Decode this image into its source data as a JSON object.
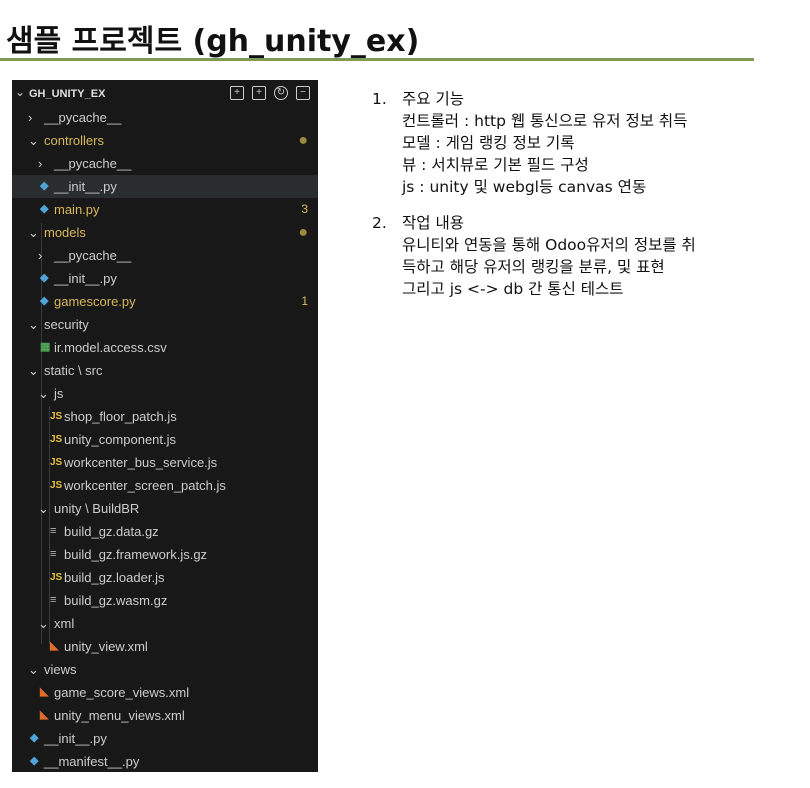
{
  "slide": {
    "title": "샘플 프로젝트 (gh_unity_ex)"
  },
  "explorer": {
    "root": "GH_UNITY_EX",
    "toolbar_icons": [
      "new-file-icon",
      "new-folder-icon",
      "refresh-icon",
      "collapse-all-icon"
    ],
    "items": [
      {
        "label": "__pycache__",
        "type": "folder",
        "collapsed": true
      },
      {
        "label": "controllers",
        "type": "folder",
        "badge": "●"
      },
      {
        "label": "__pycache__",
        "type": "folder",
        "collapsed": true
      },
      {
        "label": "__init__.py",
        "type": "py"
      },
      {
        "label": "main.py",
        "type": "py",
        "badge": "3"
      },
      {
        "label": "models",
        "type": "folder",
        "badge": "●"
      },
      {
        "label": "__pycache__",
        "type": "folder",
        "collapsed": true
      },
      {
        "label": "__init__.py",
        "type": "py"
      },
      {
        "label": "gamescore.py",
        "type": "py",
        "badge": "1"
      },
      {
        "label": "security",
        "type": "folder"
      },
      {
        "label": "ir.model.access.csv",
        "type": "csv"
      },
      {
        "label": "static \\ src",
        "type": "folder"
      },
      {
        "label": "js",
        "type": "folder"
      },
      {
        "label": "shop_floor_patch.js",
        "type": "js"
      },
      {
        "label": "unity_component.js",
        "type": "js"
      },
      {
        "label": "workcenter_bus_service.js",
        "type": "js"
      },
      {
        "label": "workcenter_screen_patch.js",
        "type": "js"
      },
      {
        "label": "unity \\ BuildBR",
        "type": "folder"
      },
      {
        "label": "build_gz.data.gz",
        "type": "gz"
      },
      {
        "label": "build_gz.framework.js.gz",
        "type": "gz"
      },
      {
        "label": "build_gz.loader.js",
        "type": "js"
      },
      {
        "label": "build_gz.wasm.gz",
        "type": "gz"
      },
      {
        "label": "xml",
        "type": "folder"
      },
      {
        "label": "unity_view.xml",
        "type": "xml"
      },
      {
        "label": "views",
        "type": "folder"
      },
      {
        "label": "game_score_views.xml",
        "type": "xml"
      },
      {
        "label": "unity_menu_views.xml",
        "type": "xml"
      },
      {
        "label": "__init__.py",
        "type": "py"
      },
      {
        "label": "__manifest__.py",
        "type": "py"
      }
    ]
  },
  "notes": [
    {
      "number": "1.",
      "lines": [
        "주요 기능",
        "컨트롤러 : http 웹 통신으로 유저 정보 취득",
        "모델 : 게임 랭킹 정보 기록",
        "뷰 : 서치뷰로 기본 필드 구성",
        "js : unity 및 webgl등 canvas 연동"
      ]
    },
    {
      "number": "2.",
      "lines": [
        "작업 내용",
        "유니티와 연동을 통해 Odoo유저의 정보를 취",
        "득하고 해당 유저의 랭킹을 분류, 및 표현",
        "그리고 js <-> db 간 통신 테스트"
      ]
    }
  ],
  "colors": {
    "explorer_bg": "#181818",
    "modified": "#d7b85a",
    "title_rule": "#7f9a55"
  }
}
